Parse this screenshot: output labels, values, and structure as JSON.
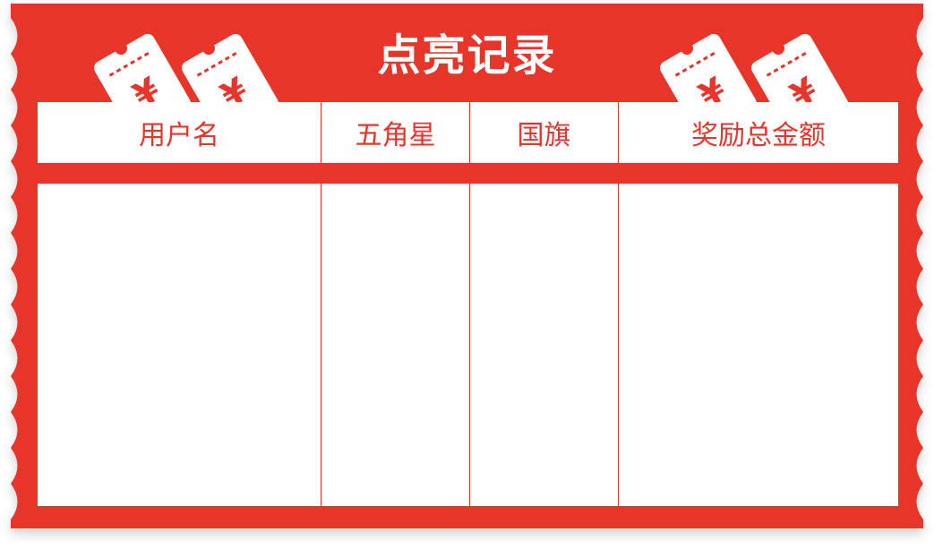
{
  "title": "点亮记录",
  "columns": [
    "用户名",
    "五角星",
    "国旗",
    "奖励总金额"
  ],
  "rows": [],
  "colors": {
    "primary_red": "#e8342a",
    "panel_white": "#ffffff"
  },
  "decorations": {
    "ticket_icon": "yen-ticket-icon",
    "ticket_glyph": "¥"
  }
}
